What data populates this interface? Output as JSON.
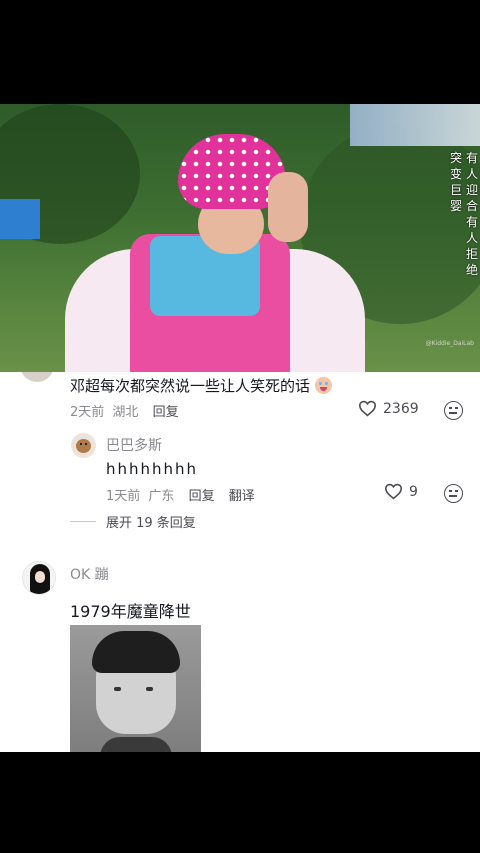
{
  "video": {
    "side_caption_right": "有人迎合有人拒绝",
    "side_caption_left": "突变巨婴",
    "watermark": "@Kiddie_DaiLab"
  },
  "comments": [
    {
      "text": "邓超每次都突然说一些让人笑死的话",
      "emoji": "baby-crying-emoji",
      "time": "2天前",
      "location": "湖北",
      "reply_label": "回复",
      "likes": "2369",
      "replies": [
        {
          "username": "巴巴多斯",
          "text": "hhhhhhhh",
          "time": "1天前",
          "location": "广东",
          "reply_label": "回复",
          "translate_label": "翻译",
          "likes": "9"
        }
      ],
      "expand_label": "展开 19 条回复"
    },
    {
      "username": "OK 蹦",
      "text": "1979年魔童降世",
      "has_photo": true
    }
  ]
}
